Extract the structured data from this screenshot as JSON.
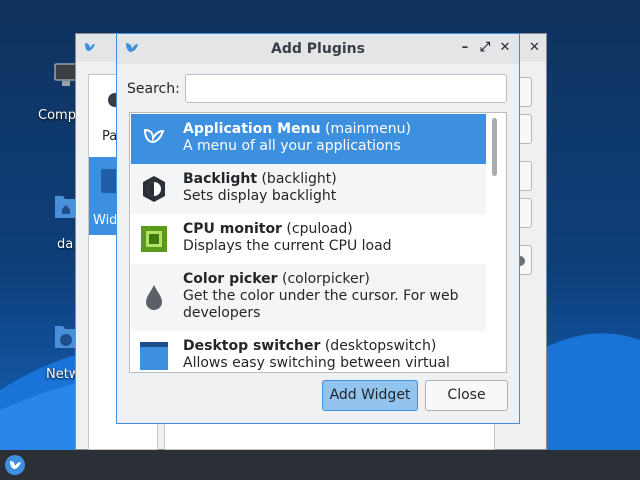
{
  "desktop": {
    "icons": [
      {
        "label": "Comp",
        "icon": "computer-icon"
      },
      {
        "label": "da",
        "icon": "folder-home-icon"
      },
      {
        "label": "Netw",
        "icon": "network-icon"
      }
    ]
  },
  "taskbar": {
    "start_icon": "start-menu-icon"
  },
  "background_window": {
    "left_list": [
      "Pa",
      "Wid"
    ]
  },
  "dialog": {
    "title": "Add Plugins",
    "search_label": "Search:",
    "search_value": "",
    "buttons": {
      "add": "Add Widget",
      "close": "Close"
    },
    "plugins": [
      {
        "name": "Application Menu",
        "id": "(mainmenu)",
        "desc": "A menu of all your applications",
        "icon": "app-menu-icon",
        "selected": true
      },
      {
        "name": "Backlight",
        "id": "(backlight)",
        "desc": "Sets display backlight",
        "icon": "backlight-icon",
        "selected": false
      },
      {
        "name": "CPU monitor",
        "id": "(cpuload)",
        "desc": "Displays the current CPU load",
        "icon": "cpu-icon",
        "selected": false
      },
      {
        "name": "Color picker",
        "id": "(colorpicker)",
        "desc": "Get the color under the cursor. For web",
        "desc2": "developers",
        "icon": "color-picker-icon",
        "selected": false
      },
      {
        "name": "Desktop switcher",
        "id": "(desktopswitch)",
        "desc": "Allows easy switching between virtual",
        "icon": "desktop-switch-icon",
        "selected": false
      }
    ]
  },
  "colors": {
    "accent": "#3d8fe0",
    "selection_text": "#ffffff",
    "desktop": "#0d3d73"
  }
}
